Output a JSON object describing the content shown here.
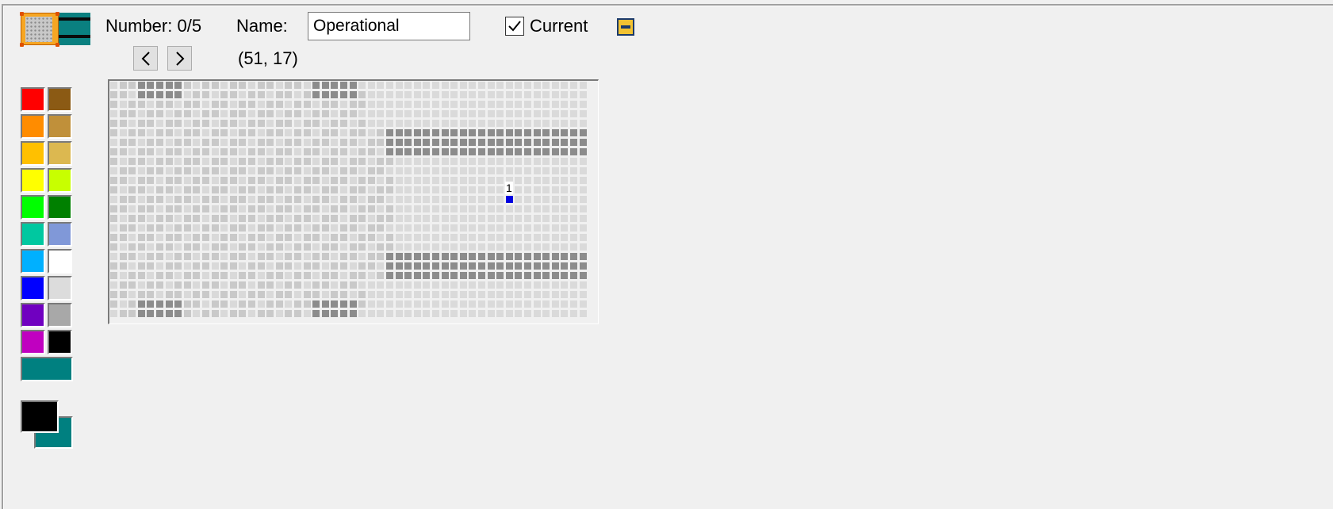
{
  "header": {
    "number_text": "Number: 0/5",
    "name_label": "Name:",
    "name_value": "Operational",
    "current_label": "Current",
    "current_checked": true,
    "coords_text": "(51, 17)"
  },
  "icons": {
    "prev": "chevron-left-icon",
    "next": "chevron-right-icon",
    "collapse": "minus-box-icon",
    "checkmark": "check-icon"
  },
  "map": {
    "cols": 52,
    "rows": 25,
    "floor_color": "#c9c9c9",
    "floor_alt_color": "#d9d9d9",
    "wall_color": "#8c8c8c",
    "light_zone_color": "#dadada",
    "marker": {
      "label": "1",
      "color": "#0000e0",
      "col": 43,
      "row": 12
    }
  },
  "palette": {
    "left": [
      "#ff0000",
      "#ff8c00",
      "#ffc000",
      "#ffff00",
      "#00ff00",
      "#00c8a0",
      "#00b0ff",
      "#0000ff",
      "#7000c0",
      "#c000c0"
    ],
    "right": [
      "#8b5a14",
      "#c0903a",
      "#dcb850",
      "#c8ff00",
      "#008000",
      "#8098d8",
      "#ffffff",
      "#dcdcdc",
      "#a8a8a8",
      "#000000"
    ],
    "wide": "#008080",
    "foreground": "#000000",
    "background": "#008080"
  }
}
